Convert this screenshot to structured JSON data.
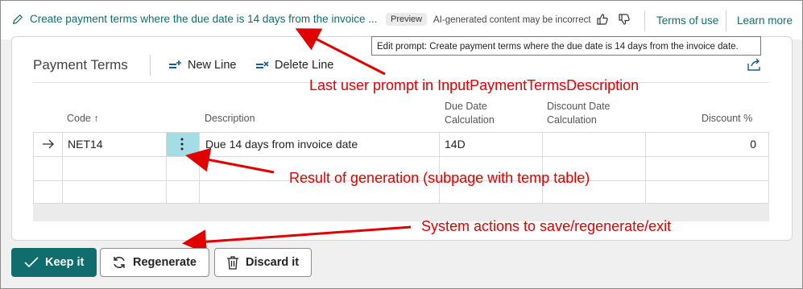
{
  "header": {
    "prompt_text": "Create payment terms where the due date is 14 days from the invoice ...",
    "badge": "Preview",
    "disclaimer": "AI-generated content may be incorrect",
    "terms_link": "Terms of use",
    "learn_more": "Learn more"
  },
  "tooltip": "Edit prompt: Create payment terms where the due date is 14 days from the invoice date.",
  "page": {
    "title": "Payment Terms",
    "new_line": "New Line",
    "delete_line": "Delete Line"
  },
  "table": {
    "columns": {
      "code": "Code ↑",
      "description": "Description",
      "due_date_calc_1": "Due Date",
      "due_date_calc_2": "Calculation",
      "discount_date_calc_1": "Discount Date",
      "discount_date_calc_2": "Calculation",
      "discount_pct": "Discount %"
    },
    "rows": [
      {
        "code": "NET14",
        "description": "Due 14 days from invoice date",
        "due_date_calc": "14D",
        "discount_date_calc": "",
        "discount_pct": "0"
      }
    ]
  },
  "annotations": {
    "prompt_note": "Last user prompt in InputPaymentTermsDescription",
    "result_note": "Result of generation (subpage with temp table)",
    "actions_note": "System actions to save/regenerate/exit"
  },
  "buttons": {
    "keep": "Keep it",
    "regenerate": "Regenerate",
    "discard": "Discard it"
  },
  "colors": {
    "accent": "#0f6d6d",
    "annotation_red": "#e00000",
    "selected_cell": "#a5dde6"
  }
}
